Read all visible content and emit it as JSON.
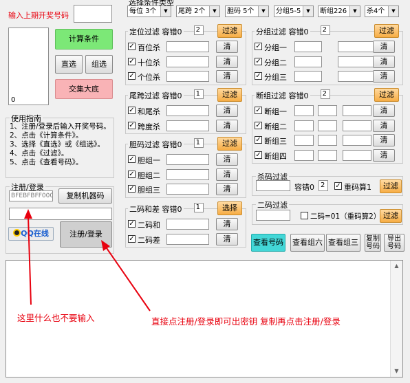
{
  "header": {
    "prev_number_label": "输入上期开奖号码",
    "dropdown_section_title": "选择条件类型"
  },
  "dropdowns": [
    "每位 3个",
    "尾跨 2个",
    "胆码 5个",
    "分组5-5",
    "断组226",
    "杀4个"
  ],
  "listbox_value": "0",
  "buttons": {
    "calc": "计算条件",
    "zhixuan": "直选",
    "zuxuan": "组选",
    "collect": "交集大底",
    "copy_machine": "复制机器码",
    "register": "注册/登录",
    "qq": "QQ在线",
    "view_numbers": "查看号码",
    "view_six": "查看组六",
    "view_three": "查看组三",
    "copy_numbers": "复制号码",
    "export_numbers": "导出号码",
    "filter": "过滤",
    "choose": "选择",
    "clear": "清"
  },
  "guide": {
    "title": "使用指南",
    "lines": [
      "1、注册/登录后输入开奖号码。",
      "2、点击《计算条件》。",
      "3、选择《直选》或《组选》。",
      "4、点击《过滤》。",
      "5、点击《查看号码》。"
    ]
  },
  "register": {
    "title": "注册/登录",
    "machine_code": "BFEBFBFF000"
  },
  "positioning": {
    "title": "定位过滤 容错0",
    "tol": "2",
    "items": [
      "百位杀",
      "十位杀",
      "个位杀"
    ]
  },
  "tail": {
    "title": "尾跨过滤 容错0",
    "tol": "1",
    "items": [
      "和尾杀",
      "跨度杀"
    ]
  },
  "dan": {
    "title": "胆码过滤 容错0",
    "tol": "1",
    "items": [
      "胆组一",
      "胆组二",
      "胆组三"
    ]
  },
  "erma": {
    "title": "二码和差 容错0",
    "tol": "1",
    "items": [
      "二码和",
      "二码差"
    ]
  },
  "group": {
    "title": "分组过滤 容错0",
    "tol": "2",
    "items": [
      "分组一",
      "分组二",
      "分组三"
    ]
  },
  "broken": {
    "title": "断组过滤 容错0",
    "tol": "2",
    "items": [
      "断组一",
      "断组二",
      "断组三",
      "断组四"
    ]
  },
  "kill": {
    "title": "杀码过滤",
    "tol_label": "容错0",
    "tol": "2",
    "repeat": "重码算1"
  },
  "twocode": {
    "title": "二码过滤",
    "label": "二码=01（重码算2）"
  },
  "annotations": {
    "left": "这里什么也不要输入",
    "right": "直接点注册/登录即可出密钥 复制再点击注册/登录"
  },
  "colors": {
    "accent_red": "#e8000e",
    "orange": "#f7ad45",
    "teal": "#43d7d7",
    "green": "#7ce877",
    "pink": "#f9b3b6"
  }
}
